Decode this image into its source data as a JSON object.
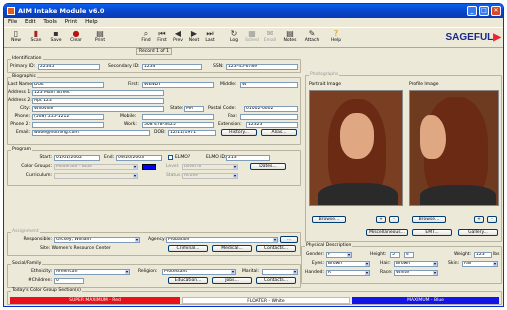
{
  "window": {
    "title": "AIM Intake Module v6.0",
    "min": "_",
    "max": "□",
    "close": "✕"
  },
  "menu": [
    "File",
    "Edit",
    "Tools",
    "Print",
    "Help"
  ],
  "toolbar": [
    {
      "label": "New",
      "icon": "▯"
    },
    {
      "label": "Scan",
      "icon": "▮"
    },
    {
      "label": "Save",
      "icon": "▪"
    },
    {
      "label": "Clear",
      "icon": "●"
    },
    {
      "label": "Print",
      "icon": "▤"
    },
    {
      "label": "Find",
      "icon": "⌕"
    },
    {
      "label": "First",
      "icon": "⏮"
    },
    {
      "label": "Prev",
      "icon": "◀"
    },
    {
      "label": "Next",
      "icon": "▶"
    },
    {
      "label": "Last",
      "icon": "⏭"
    },
    {
      "label": "Log",
      "icon": "↻"
    },
    {
      "label": "Sched",
      "icon": "▦"
    },
    {
      "label": "Email",
      "icon": "✉"
    },
    {
      "label": "Notes",
      "icon": "▤"
    },
    {
      "label": "Attach",
      "icon": "✎"
    },
    {
      "label": "Help",
      "icon": "?"
    }
  ],
  "logo": {
    "main": "SAGEFUL",
    "accent": "▶"
  },
  "record": "Record 1 of 1",
  "identification": {
    "legend": "Identification",
    "primary_id_label": "Primary ID:",
    "primary_id": "22345",
    "secondary_id_label": "Secondary ID:",
    "secondary_id": "1234",
    "ssn_label": "SSN:",
    "ssn": "123-45-6789"
  },
  "biographic": {
    "legend": "Biographic",
    "last_label": "Last Name:",
    "last": "DOE",
    "first_label": "First:",
    "first": "WENDY",
    "middle_label": "Middle:",
    "middle": "W",
    "addr1_label": "Address 1:",
    "addr1": "123 Main Street",
    "addr2_label": "Address 2:",
    "addr2": "Apt 123",
    "city_label": "City:",
    "city": "Whoville",
    "state_label": "State:",
    "state": "MA",
    "postal_label": "Postal Code:",
    "postal": "01002-0002",
    "phone_label": "Phone:",
    "phone": "(508) 555-1212",
    "mobile_label": "Mobile:",
    "mobile": "",
    "fax_label": "Fax:",
    "fax": "",
    "phone2_label": "Phone 2:",
    "phone2": "",
    "work_label": "Work:",
    "work": "508 478-3425",
    "ext_label": "Extension:",
    "ext": "12323",
    "email_label": "Email:",
    "email": "wdoe@nothing.com",
    "dob_label": "DOB:",
    "dob": "12/11/1971",
    "history_btn": "History...",
    "alias_btn": "Alias..."
  },
  "program": {
    "legend": "Program",
    "start_label": "Start:",
    "start": "01/01/2002",
    "end_label": "End:",
    "end": "09/20/2003",
    "elmo_label": "ELMO?",
    "elmo_id_label": "ELMO ID:",
    "elmo_id": "213",
    "color_label": "Color Groups:",
    "color": "Moderate - Blue",
    "level_label": "Level:",
    "level": "Level III",
    "dates_btn": "Dates...",
    "curriculum_label": "Curriculum:",
    "curriculum": "",
    "status_label": "Status:",
    "status": "Active"
  },
  "assignment": {
    "legend": "Assignment",
    "resp_label": "Responsible:",
    "resp": "Orcsey, William",
    "agency_label": "Agency:",
    "agency": "Probation",
    "site_text": "Site: Women's Resource Center",
    "criminal_btn": "Criminal...",
    "medical_btn": "Medical...",
    "contacts_btn": "Contacts..."
  },
  "social": {
    "legend": "Social/Family",
    "ethnicity_label": "Ethnicity:",
    "ethnicity": "American",
    "religion_label": "Religion:",
    "religion": "Protestant",
    "marital_label": "Marital:",
    "marital": "",
    "children_label": "#Children:",
    "children": "0",
    "education_btn": "Education...",
    "jobs_btn": "Jobs...",
    "contacts_btn": "Contacts..."
  },
  "photographs": {
    "legend": "Photographs",
    "portrait_label": "Portrait Image",
    "profile_label": "Profile Image",
    "browse": "Browse...",
    "plus": "+",
    "minus": "-",
    "misc_btn": "Miscellaneous...",
    "emt_btn": "EMT...",
    "gallery_btn": "Gallery..."
  },
  "physical": {
    "legend": "Physical Description",
    "gender_label": "Gender:",
    "gender": "F",
    "height_label": "Height:",
    "height_ft": "5",
    "height_in": "4",
    "weight_label": "Weight:",
    "weight": "123",
    "weight_unit": "lbs",
    "eyes_label": "Eyes:",
    "eyes": "Brown",
    "hair_label": "Hair:",
    "hair": "Brown",
    "skin_label": "Skin:",
    "skin": "Fair",
    "handed_label": "Handed:",
    "handed": "R",
    "race_label": "Race:",
    "race": "White"
  },
  "color_groups": {
    "legend": "Today's Color Group Section(s)",
    "red": "SUPER MAXIMUM - Red",
    "white": "FLOATER - White",
    "blue": "MAXIMUM - Blue",
    "colors": {
      "red": "#e8111b",
      "blue": "#1414e6"
    }
  }
}
